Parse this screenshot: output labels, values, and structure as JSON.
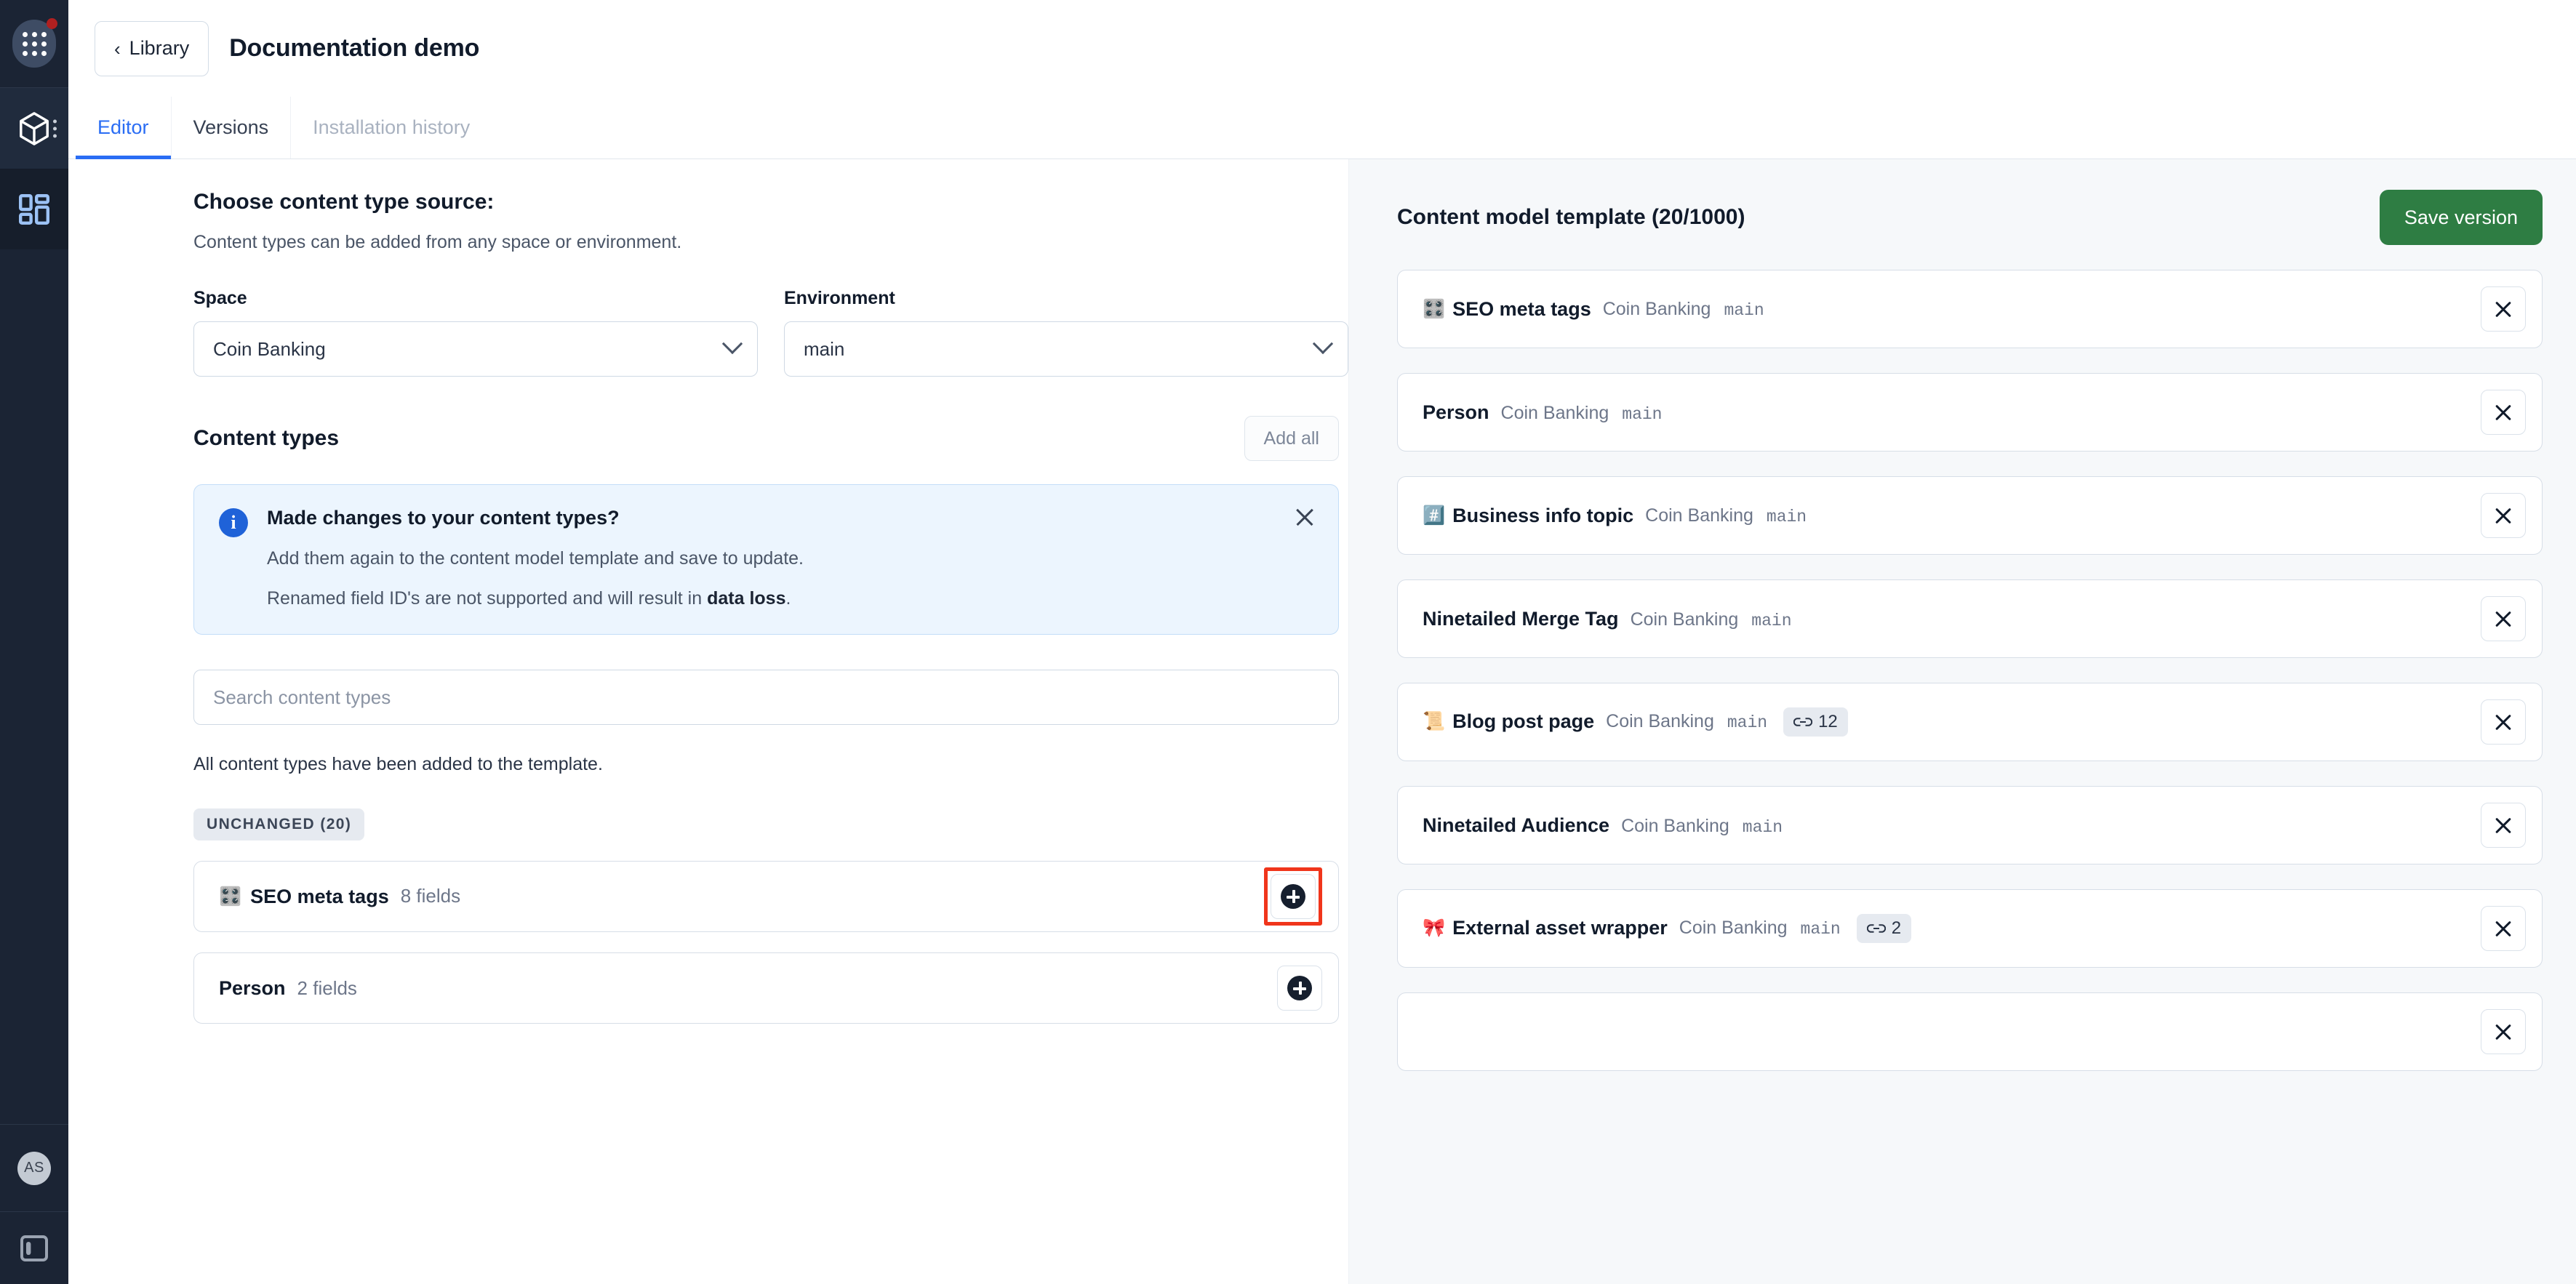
{
  "rail": {
    "apps_icon": "apps-grid-icon",
    "notification_dot": true,
    "space_icon": "cube-icon",
    "kebab_icon": "kebab-menu-icon",
    "apps_panel_icon": "blocks-icon",
    "avatar_initials": "AS",
    "panel_toggle_icon": "sidebar-toggle-icon"
  },
  "topbar": {
    "back_label": "Library",
    "back_icon": "chevron-left-icon",
    "title": "Documentation demo"
  },
  "tabs": [
    {
      "label": "Editor",
      "state": "active"
    },
    {
      "label": "Versions",
      "state": "default"
    },
    {
      "label": "Installation history",
      "state": "disabled"
    }
  ],
  "left": {
    "heading": "Choose content type source:",
    "subheading": "Content types can be added from any space or environment.",
    "space": {
      "label": "Space",
      "value": "Coin Banking",
      "chevron": "chevron-down-icon"
    },
    "environment": {
      "label": "Environment",
      "value": "main",
      "chevron": "chevron-down-icon"
    },
    "content_types_heading": "Content types",
    "add_all_label": "Add all",
    "notice": {
      "icon": "info-icon",
      "icon_glyph": "i",
      "title": "Made changes to your content types?",
      "line1": "Add them again to the content model template and save to update.",
      "line2_prefix": "Renamed field ID's are not supported and will result in ",
      "line2_bold": "data loss",
      "line2_suffix": ".",
      "close_icon": "close-icon"
    },
    "search_placeholder": "Search content types",
    "all_added_text": "All content types have been added to the template.",
    "group_chip": "UNCHANGED (20)",
    "items": [
      {
        "emoji": "🎛️",
        "name": "SEO meta tags",
        "fields": "8 fields",
        "add_icon": "plus-icon",
        "highlighted": true
      },
      {
        "emoji": "",
        "name": "Person",
        "fields": "2 fields",
        "add_icon": "plus-icon",
        "highlighted": false
      }
    ]
  },
  "right": {
    "title": "Content model template (20/1000)",
    "save_label": "Save version",
    "save_color": "#2e7d43",
    "remove_icon": "close-icon",
    "link_icon": "link-icon",
    "items": [
      {
        "emoji": "🎛️",
        "name": "SEO meta tags",
        "space": "Coin Banking",
        "env": "main",
        "links": ""
      },
      {
        "emoji": "",
        "name": "Person",
        "space": "Coin Banking",
        "env": "main",
        "links": ""
      },
      {
        "emoji": "#️⃣",
        "name": "Business info topic",
        "space": "Coin Banking",
        "env": "main",
        "links": ""
      },
      {
        "emoji": "",
        "name": "Ninetailed Merge Tag",
        "space": "Coin Banking",
        "env": "main",
        "links": ""
      },
      {
        "emoji": "📜",
        "name": "Blog post page",
        "space": "Coin Banking",
        "env": "main",
        "links": "12"
      },
      {
        "emoji": "",
        "name": "Ninetailed Audience",
        "space": "Coin Banking",
        "env": "main",
        "links": ""
      },
      {
        "emoji": "🎀",
        "name": "External asset wrapper",
        "space": "Coin Banking",
        "env": "main",
        "links": "2"
      }
    ]
  }
}
